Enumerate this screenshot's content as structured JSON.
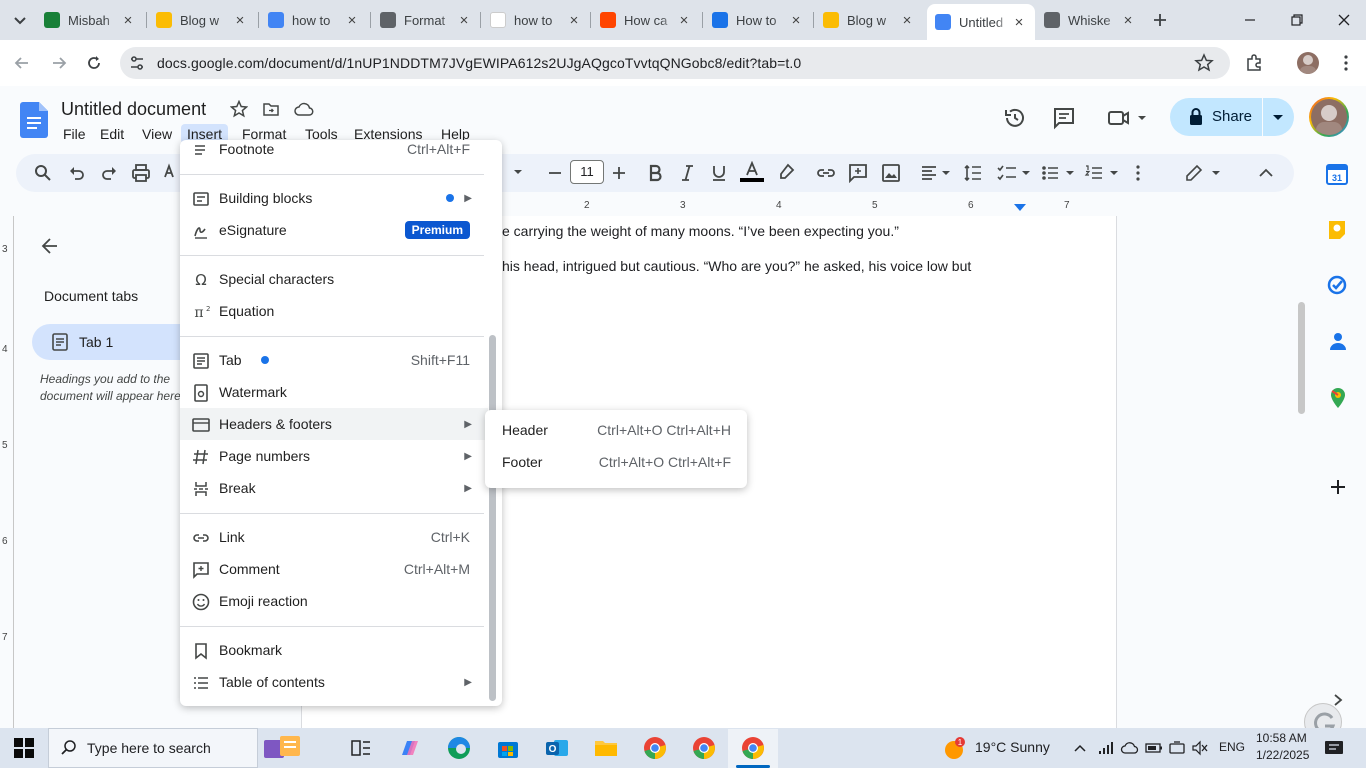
{
  "browser": {
    "tabs": [
      {
        "title": "Misbah",
        "fav_color": "#188038",
        "fav": "sheets-icon"
      },
      {
        "title": "Blog w",
        "fav_color": "#fbbc04",
        "fav": "drive-icon"
      },
      {
        "title": "how to",
        "fav_color": "#4285f4",
        "fav": "docs-icon"
      },
      {
        "title": "Format",
        "fav_color": "#5f6368",
        "fav": "openai-icon"
      },
      {
        "title": "how to",
        "fav_color": "#ffffff",
        "fav": "google-icon"
      },
      {
        "title": "How ca",
        "fav_color": "#ff4500",
        "fav": "reddit-icon"
      },
      {
        "title": "How to",
        "fav_color": "#1a73e8",
        "fav": "quillbot-icon"
      },
      {
        "title": "Blog w",
        "fav_color": "#fbbc04",
        "fav": "drive-icon"
      },
      {
        "title": "Untitled",
        "fav_color": "#4285f4",
        "fav": "docs-icon"
      },
      {
        "title": "Whiske",
        "fav_color": "#5f6368",
        "fav": "openai-icon"
      }
    ],
    "url": "docs.google.com/document/d/1nUP1NDDTM7JVgEWIPA612s2UJgAQgcoTvvtqQNGobc8/edit?tab=t.0"
  },
  "docs": {
    "title": "Untitled document",
    "menu": [
      "File",
      "Edit",
      "View",
      "Insert",
      "Format",
      "Tools",
      "Extensions",
      "Help"
    ],
    "share_label": "Share",
    "font_size": "11",
    "ruler_numbers": [
      "2",
      "3",
      "4",
      "5",
      "6",
      "7"
    ],
    "vruler_numbers": [
      "3",
      "4",
      "5",
      "6",
      "7"
    ],
    "paragraphs": [
      "e carrying the weight of many moons. “I’ve been expecting you.”",
      "his head, intrigued but cautious. “Who are you?” he asked, his voice low but"
    ]
  },
  "doc_tabs": {
    "title": "Document tabs",
    "tab1": "Tab 1",
    "hint": "Headings you add to the document will appear here."
  },
  "insert_menu": {
    "items": [
      {
        "label": "Footnote",
        "shortcut": "Ctrl+Alt+F",
        "icon": "footnote-icon"
      },
      {
        "label": "Building blocks",
        "icon": "building-blocks-icon"
      },
      {
        "label": "eSignature",
        "icon": "esignature-icon",
        "badge": "Premium"
      },
      {
        "label": "Special characters",
        "icon": "omega-icon"
      },
      {
        "label": "Equation",
        "icon": "pi-icon"
      },
      {
        "label": "Tab",
        "shortcut": "Shift+F11",
        "icon": "tab-icon"
      },
      {
        "label": "Watermark",
        "icon": "watermark-icon"
      },
      {
        "label": "Headers & footers",
        "icon": "header-footer-icon"
      },
      {
        "label": "Page numbers",
        "icon": "hash-icon"
      },
      {
        "label": "Break",
        "icon": "break-icon"
      },
      {
        "label": "Link",
        "shortcut": "Ctrl+K",
        "icon": "link-icon"
      },
      {
        "label": "Comment",
        "shortcut": "Ctrl+Alt+M",
        "icon": "comment-icon"
      },
      {
        "label": "Emoji reaction",
        "icon": "emoji-icon"
      },
      {
        "label": "Bookmark",
        "icon": "bookmark-icon"
      },
      {
        "label": "Table of contents",
        "icon": "toc-icon"
      }
    ]
  },
  "submenu": {
    "header": {
      "label": "Header",
      "shortcut": "Ctrl+Alt+O Ctrl+Alt+H"
    },
    "footer": {
      "label": "Footer",
      "shortcut": "Ctrl+Alt+O Ctrl+Alt+F"
    }
  },
  "taskbar": {
    "search_placeholder": "Type here to search",
    "weather": "19°C  Sunny",
    "weather_badge": "1",
    "lang": "ENG",
    "time": "10:58 AM",
    "date": "1/22/2025"
  }
}
